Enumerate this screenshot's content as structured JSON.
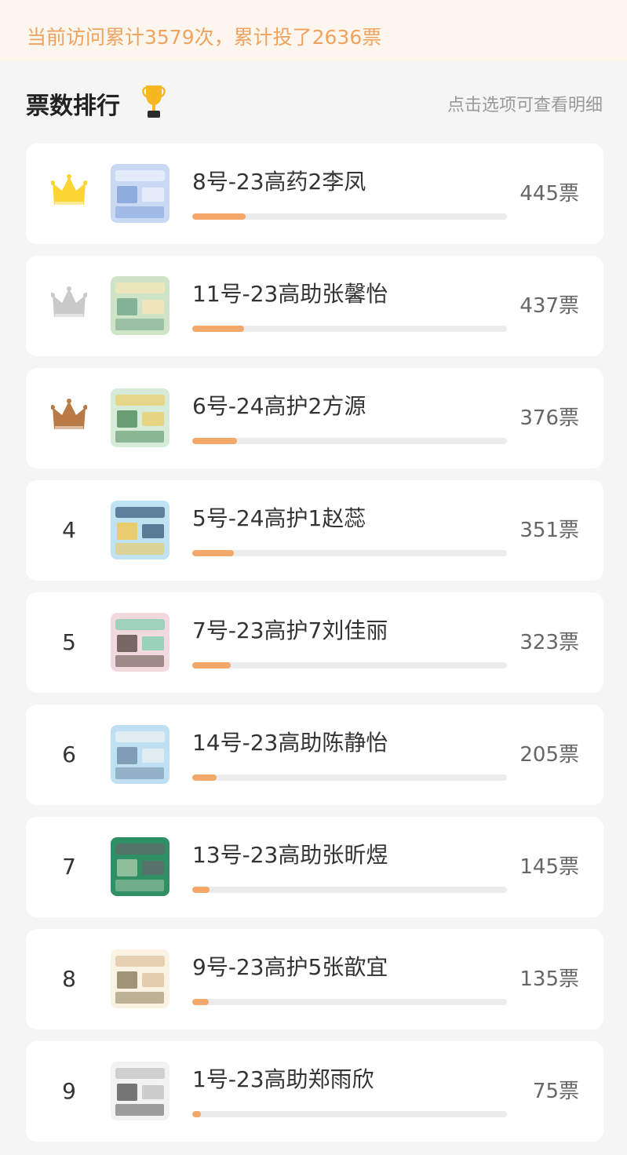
{
  "banner": {
    "text": "当前访问累计3579次，累计投了2636票"
  },
  "header": {
    "title": "票数排行",
    "hint": "点击选项可查看明细",
    "trophy_icon": "trophy-icon"
  },
  "colors": {
    "accent": "#f3a769",
    "banner_text": "#f0a35f",
    "gold": "#fcd535",
    "silver": "#c9c9c9",
    "bronze": "#b97a45"
  },
  "rankings": [
    {
      "rank": "1",
      "crown": "gold",
      "name": "8号-23高药2李凤",
      "votes": "445票",
      "count": 445,
      "thumb": [
        "#c9d8f3",
        "#7fa1d8",
        "#e9f0fb"
      ]
    },
    {
      "rank": "2",
      "crown": "silver",
      "name": "11号-23高助张馨怡",
      "votes": "437票",
      "count": 437,
      "thumb": [
        "#cfe3c6",
        "#6fa58a",
        "#f1e6b8"
      ]
    },
    {
      "rank": "3",
      "crown": "bronze",
      "name": "6号-24高护2方源",
      "votes": "376票",
      "count": 376,
      "thumb": [
        "#d7ecd8",
        "#4d8a5b",
        "#e7d27b"
      ]
    },
    {
      "rank": "4",
      "crown": "",
      "name": "5号-24高护1赵蕊",
      "votes": "351票",
      "count": 351,
      "thumb": [
        "#bfe3f2",
        "#f3c64c",
        "#4c6f8d"
      ]
    },
    {
      "rank": "5",
      "crown": "",
      "name": "7号-23高护7刘佳丽",
      "votes": "323票",
      "count": 323,
      "thumb": [
        "#f1d9dd",
        "#5a4a45",
        "#8fd0b7"
      ]
    },
    {
      "rank": "6",
      "crown": "",
      "name": "14号-23高助陈静怡",
      "votes": "205票",
      "count": 205,
      "thumb": [
        "#bfe0f2",
        "#6f8ca6",
        "#e6eef3"
      ]
    },
    {
      "rank": "7",
      "crown": "",
      "name": "13号-23高助张昕煜",
      "votes": "145票",
      "count": 145,
      "thumb": [
        "#2f8f65",
        "#a6c9a8",
        "#5b6f6a"
      ]
    },
    {
      "rank": "8",
      "crown": "",
      "name": "9号-23高护5张歆宜",
      "votes": "135票",
      "count": 135,
      "thumb": [
        "#faf3e3",
        "#8a7a5a",
        "#e0c9a6"
      ]
    },
    {
      "rank": "9",
      "crown": "",
      "name": "1号-23高助郑雨欣",
      "votes": "75票",
      "count": 75,
      "thumb": [
        "#f2f2f2",
        "#555555",
        "#c9c9c9"
      ]
    }
  ],
  "max_count": 2636
}
